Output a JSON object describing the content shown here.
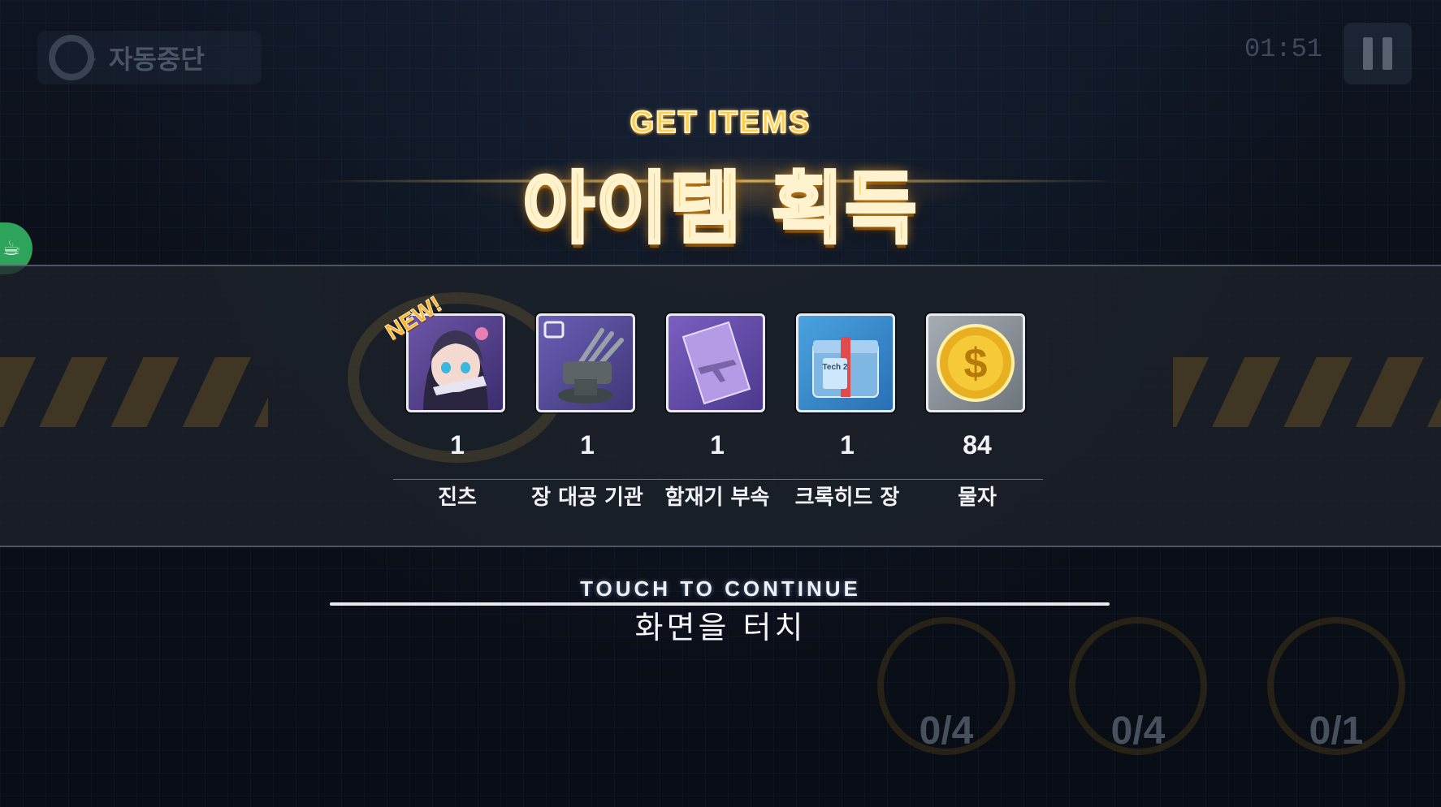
{
  "hud": {
    "auto_label": "자동중단",
    "timer": "01:51"
  },
  "title": {
    "en": "GET ITEMS",
    "ko": "아이템 획득"
  },
  "items": [
    {
      "name": "진츠",
      "qty": "1",
      "badge": "NEW!",
      "icon": "character-portrait-icon"
    },
    {
      "name": "장 대공 기관",
      "qty": "1",
      "icon": "anti-air-gun-icon"
    },
    {
      "name": "함재기 부속",
      "qty": "1",
      "icon": "aircraft-part-icon"
    },
    {
      "name": "크록히드 장",
      "qty": "1",
      "icon": "tech-box-icon",
      "box_text": "Tech 2"
    },
    {
      "name": "물자",
      "qty": "84",
      "icon": "coin-icon"
    }
  ],
  "continue": {
    "en": "TOUCH TO CONTINUE",
    "ko": "화면을 터치"
  },
  "gauges": [
    "0/4",
    "0/4",
    "0/1"
  ],
  "colors": {
    "title_gold": "#ffc23a",
    "frame_border": "#e8ecf2",
    "side_tab_green": "#2ea35b"
  }
}
